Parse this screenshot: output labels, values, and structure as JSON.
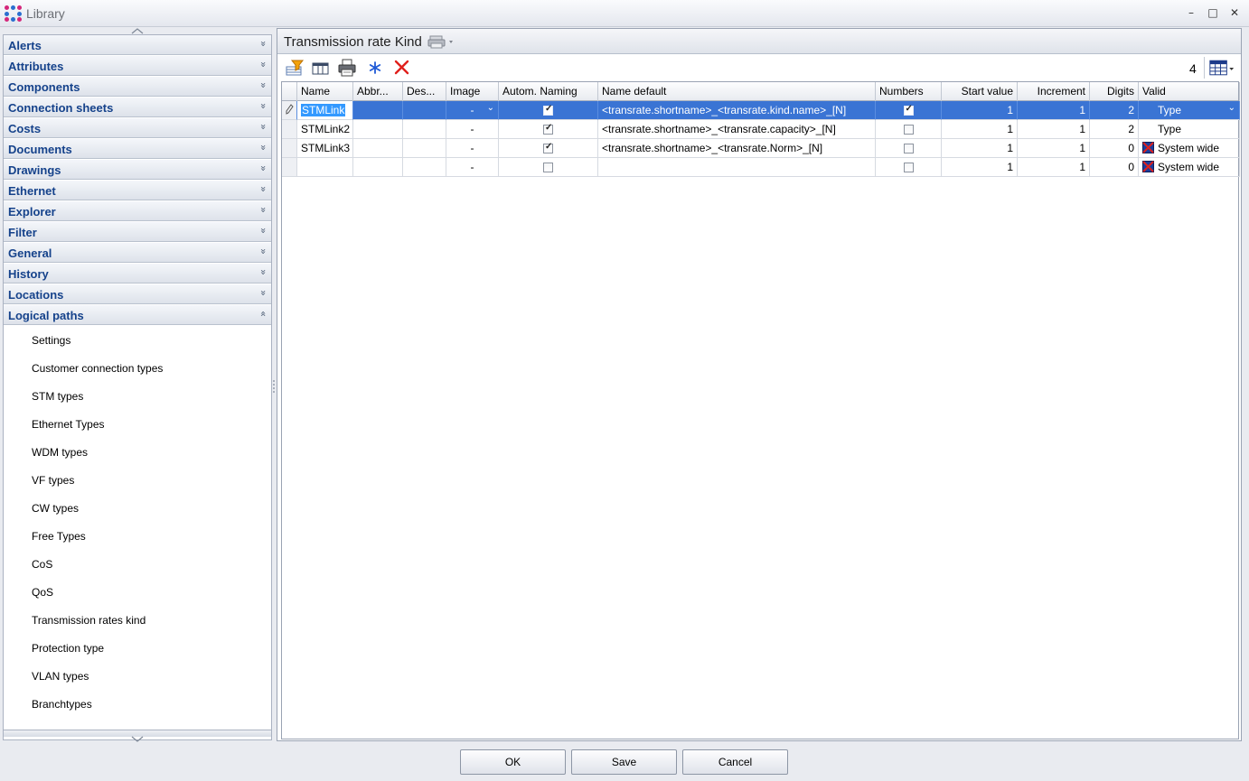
{
  "window": {
    "title": "Library",
    "minimize": "–",
    "maximize": "□",
    "close": "✕"
  },
  "sidebar": {
    "groups": [
      {
        "label": "Alerts",
        "expanded": false
      },
      {
        "label": "Attributes",
        "expanded": false
      },
      {
        "label": "Components",
        "expanded": false
      },
      {
        "label": "Connection sheets",
        "expanded": false
      },
      {
        "label": "Costs",
        "expanded": false
      },
      {
        "label": "Documents",
        "expanded": false
      },
      {
        "label": "Drawings",
        "expanded": false
      },
      {
        "label": "Ethernet",
        "expanded": false
      },
      {
        "label": "Explorer",
        "expanded": false
      },
      {
        "label": "Filter",
        "expanded": false
      },
      {
        "label": "General",
        "expanded": false
      },
      {
        "label": "History",
        "expanded": false
      },
      {
        "label": "Locations",
        "expanded": false
      },
      {
        "label": "Logical paths",
        "expanded": true
      }
    ],
    "expand_glyph": "»",
    "collapse_glyph": "«",
    "items": [
      "Settings",
      "Customer connection types",
      "STM types",
      "Ethernet Types",
      "WDM types",
      "VF types",
      "CW types",
      "Free Types",
      "CoS",
      "QoS",
      "Transmission rates kind",
      "Protection type",
      "VLAN types",
      "Branchtypes"
    ]
  },
  "main": {
    "title": "Transmission rate Kind",
    "record_count": "4",
    "toolbar_icons": [
      "filter-icon",
      "column-chooser-icon",
      "print-icon",
      "freeze-icon",
      "delete-icon"
    ],
    "columns": [
      "Name",
      "Abbr...",
      "Des...",
      "Image",
      "Autom. Naming",
      "Name default",
      "Numbers",
      "Start value",
      "Increment",
      "Digits",
      "Valid"
    ],
    "rows": [
      {
        "name": "STMLink",
        "abbr": "",
        "desc": "",
        "image": "-",
        "autom_naming": true,
        "name_default": "<transrate.shortname>_<transrate.kind.name>_[N]",
        "numbers": true,
        "start_value": "1",
        "increment": "1",
        "digits": "2",
        "valid": "Type",
        "valid_icon": false,
        "selected": true
      },
      {
        "name": "STMLink2",
        "abbr": "",
        "desc": "",
        "image": "-",
        "autom_naming": true,
        "name_default": "<transrate.shortname>_<transrate.capacity>_[N]",
        "numbers": false,
        "start_value": "1",
        "increment": "1",
        "digits": "2",
        "valid": "Type",
        "valid_icon": false,
        "selected": false
      },
      {
        "name": "STMLink3",
        "abbr": "",
        "desc": "",
        "image": "-",
        "autom_naming": true,
        "name_default": "<transrate.shortname>_<transrate.Norm>_[N]",
        "numbers": false,
        "start_value": "1",
        "increment": "1",
        "digits": "0",
        "valid": "System wide",
        "valid_icon": true,
        "selected": false
      },
      {
        "name": "",
        "abbr": "",
        "desc": "",
        "image": "-",
        "autom_naming": false,
        "name_default": "",
        "numbers": false,
        "start_value": "1",
        "increment": "1",
        "digits": "0",
        "valid": "System wide",
        "valid_icon": true,
        "selected": false
      }
    ]
  },
  "footer": {
    "ok": "OK",
    "save": "Save",
    "cancel": "Cancel"
  },
  "colors": {
    "group_text": "#15428b",
    "selection": "#3a74d4",
    "delete_red": "#e0201c"
  }
}
